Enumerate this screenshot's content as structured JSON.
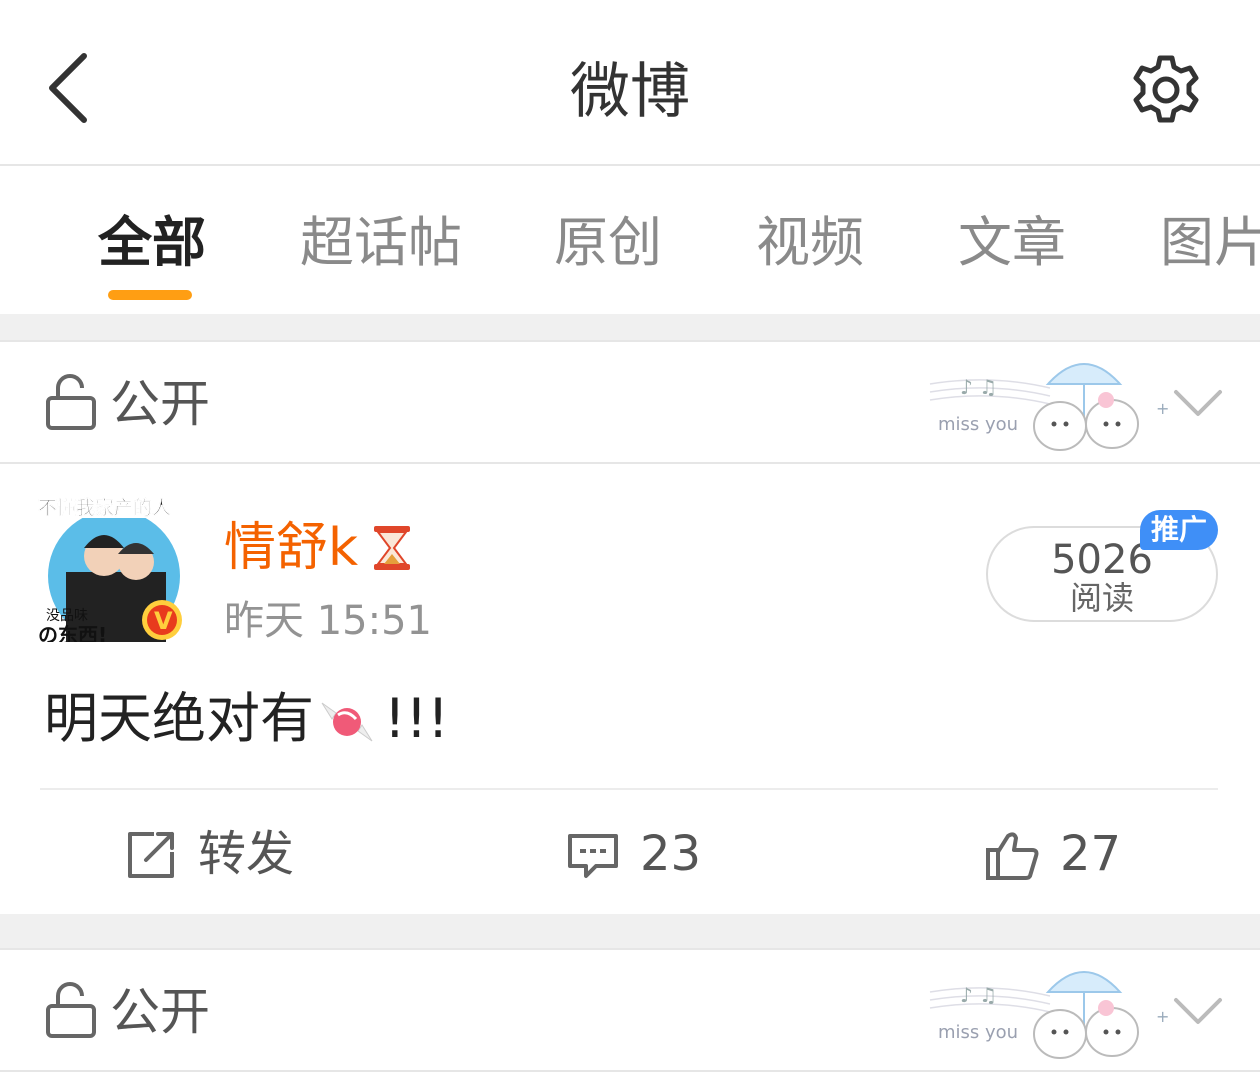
{
  "header": {
    "title": "微博"
  },
  "tabs": [
    {
      "label": "全部"
    },
    {
      "label": "超话帖"
    },
    {
      "label": "原创"
    },
    {
      "label": "视频"
    },
    {
      "label": "文章"
    },
    {
      "label": "图片"
    }
  ],
  "visibility": {
    "label": "公开"
  },
  "post": {
    "username": "情舒k",
    "timestamp": "昨天 15:51",
    "reads_count": "5026",
    "reads_label": "阅读",
    "promo_badge": "推广",
    "text": "明天绝对有",
    "text_suffix": "!!!",
    "actions": {
      "repost": "转发",
      "comments": "23",
      "likes": "27"
    }
  },
  "sticker": {
    "caption": "miss you"
  },
  "avatar": {
    "top_text": "不懂我家产的人",
    "bottom_text": "の东西!",
    "mid_text": "没品味"
  },
  "colors": {
    "accent": "#ff9e13",
    "username": "#f46200",
    "promo": "#3f8ff7"
  }
}
